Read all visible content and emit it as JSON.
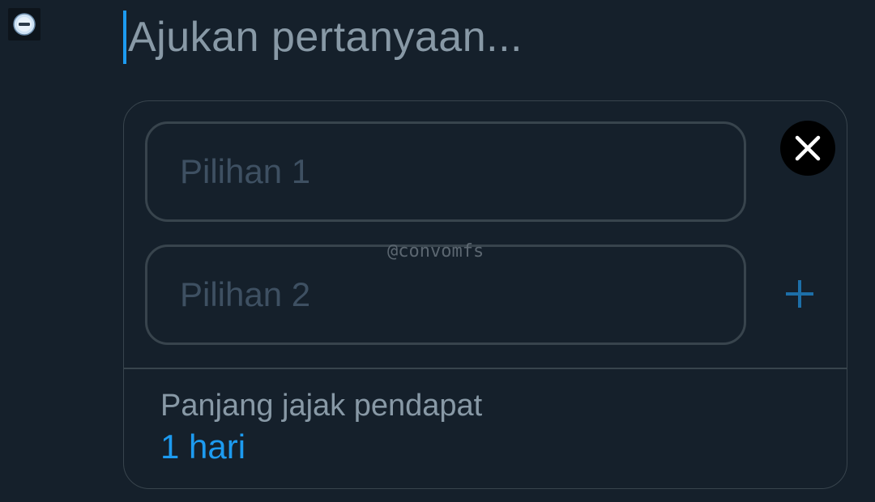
{
  "question": {
    "placeholder": "Ajukan pertanyaan..."
  },
  "poll": {
    "choices": [
      {
        "placeholder": "Pilihan 1"
      },
      {
        "placeholder": "Pilihan 2"
      }
    ],
    "remove_icon": "close-icon",
    "add_icon": "plus-icon",
    "duration": {
      "label": "Panjang jajak pendapat",
      "value": "1 hari"
    }
  },
  "watermark": "@convomfs",
  "colors": {
    "background": "#15202b",
    "accent": "#1d9bf0",
    "border": "#38444d",
    "muted_text": "#8899a6",
    "placeholder_text": "#3e5062"
  }
}
